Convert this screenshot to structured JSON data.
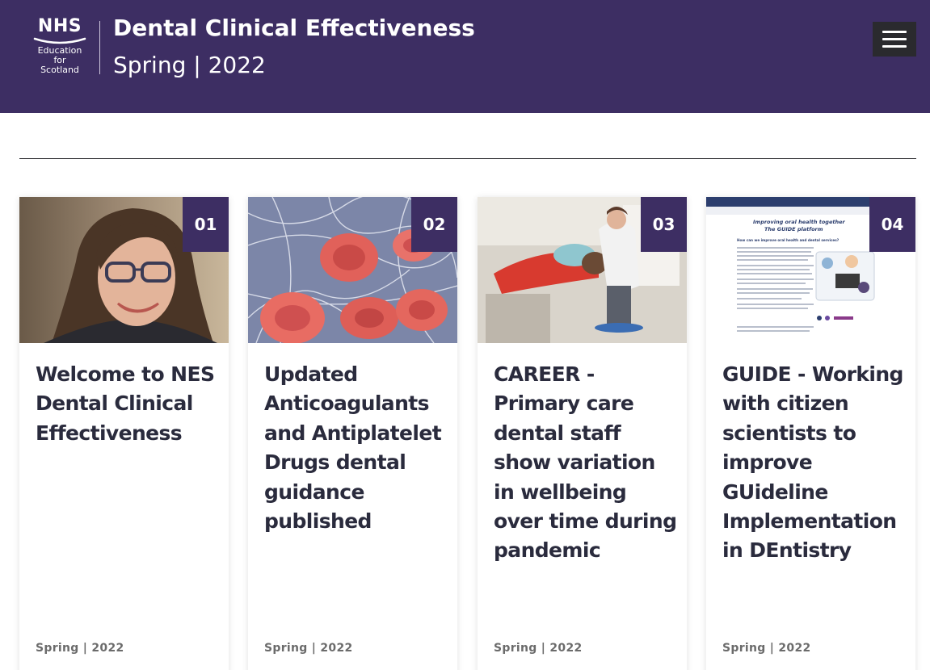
{
  "header": {
    "logo": {
      "nhs": "NHS",
      "line1": "Education",
      "line2": "for",
      "line3": "Scotland"
    },
    "title": "Dental Clinical Effectiveness",
    "edition": "Spring | 2022",
    "menu_icon": "hamburger-menu-icon"
  },
  "colors": {
    "brand": "#3d2e63",
    "menu_button": "#2a2a2e",
    "text": "#2a2b3d",
    "meta": "#6b6b6b"
  },
  "cards": [
    {
      "number": "01",
      "title": "Welcome to NES Dental Clinical Effectiveness",
      "meta": "Spring | 2022",
      "image": "woman-portrait-photo"
    },
    {
      "number": "02",
      "title": "Updated Anticoagulants and Antiplatelet Drugs dental guidance published",
      "meta": "Spring | 2022",
      "image": "red-blood-cells-micrograph"
    },
    {
      "number": "03",
      "title": "CAREER - Primary care dental staff show variation in wellbeing over time during pandemic",
      "meta": "Spring | 2022",
      "image": "dental-treatment-photo"
    },
    {
      "number": "04",
      "title": "GUIDE - Working with citizen scientists to improve GUideline Implementation in DEntistry",
      "meta": "Spring | 2022",
      "image": "guide-platform-webpage-screenshot",
      "screenshot": {
        "heading_line1": "Improving oral health together",
        "heading_line2": "The GUIDE platform",
        "question": "How can we improve oral health and dental services?"
      }
    }
  ]
}
